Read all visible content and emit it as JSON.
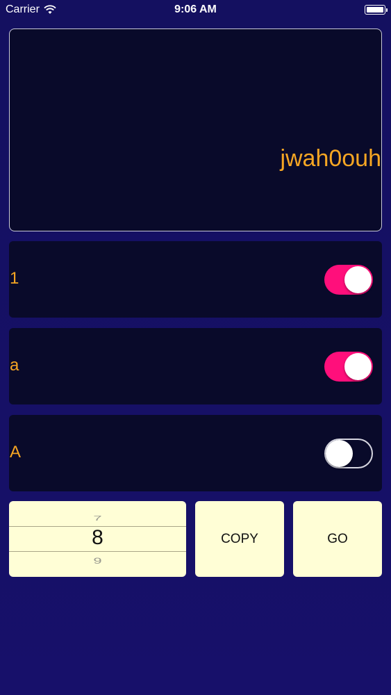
{
  "status_bar": {
    "carrier": "Carrier",
    "time": "9:06 AM",
    "icons": [
      "wifi-icon",
      "battery-icon"
    ]
  },
  "display": {
    "text": "jwah0ouh"
  },
  "options": [
    {
      "label": "1",
      "enabled": true
    },
    {
      "label": "a",
      "enabled": true
    },
    {
      "label": "A",
      "enabled": false
    }
  ],
  "picker": {
    "previous": "7",
    "selected": "8",
    "next": "9"
  },
  "buttons": {
    "copy": "COPY",
    "go": "GO"
  },
  "colors": {
    "background": "#141060",
    "panel": "#090a2a",
    "accent_text": "#f6a623",
    "toggle_on": "#ff0f7b",
    "control_bg": "#fffed6"
  }
}
